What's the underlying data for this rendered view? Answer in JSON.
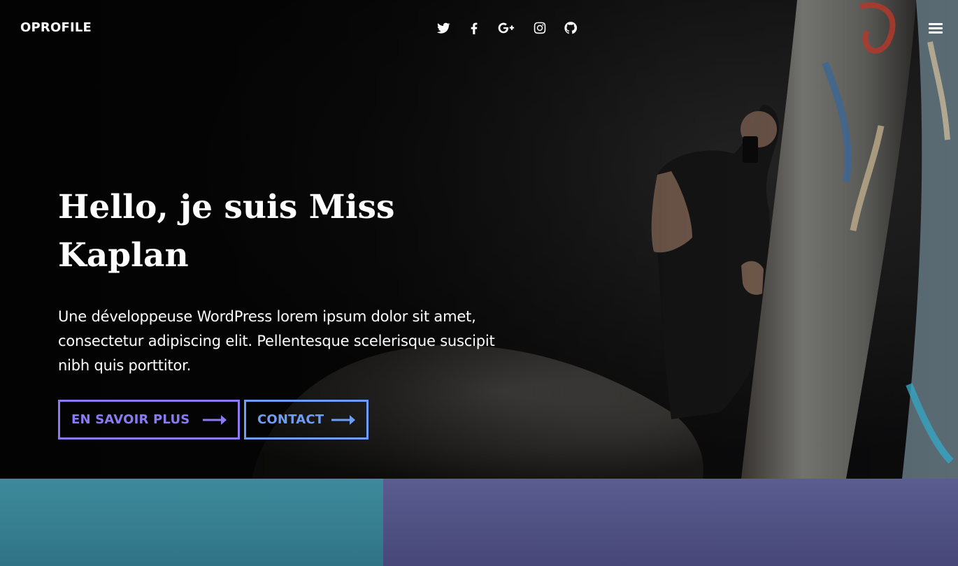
{
  "brand": "OPROFILE",
  "social": [
    {
      "icon": "twitter-icon"
    },
    {
      "icon": "facebook-icon"
    },
    {
      "icon": "google-plus-icon"
    },
    {
      "icon": "instagram-icon"
    },
    {
      "icon": "github-icon"
    }
  ],
  "menu_icon": "hamburger-menu-icon",
  "hero": {
    "headline_line1": "Hello, je suis Miss",
    "headline_line2": "Kaplan",
    "lead": "Une développeuse WordPress lorem ipsum dolor sit amet, consectetur adipiscing elit. Pellentesque scelerisque suscipit nibh quis porttitor.",
    "cta_primary": "EN SAVOIR PLUS",
    "cta_secondary": "CONTACT"
  },
  "colors": {
    "accent_primary": "#8b7bf2",
    "accent_secondary": "#6f9cf5",
    "strip_left": "#3e8a9c",
    "strip_right": "#5b5c8f"
  }
}
